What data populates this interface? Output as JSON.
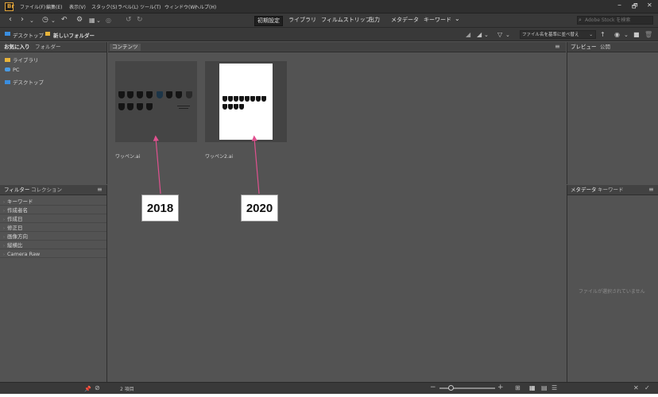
{
  "menubar": {
    "logo": "Br",
    "items": [
      "ファイル(F)",
      "編集(E)",
      "表示(V)",
      "スタック(S)",
      "ラベル(L)",
      "ツール(T)",
      "ウィンドウ(W)",
      "ヘルプ(H)"
    ],
    "minimize": "–",
    "restore": "🗗",
    "close": "✕"
  },
  "toolbar": {
    "workspaces": [
      "初期設定",
      "ライブラリ",
      "フィルムストリップ",
      "出力",
      "メタデータ",
      "キーワード"
    ],
    "more": "⌄",
    "search_placeholder": "Adobe Stock を検索"
  },
  "pathbar": {
    "crumbs": [
      "デスクトップ",
      "新しいフォルダー"
    ],
    "separator": "›",
    "sort_label": "ファイル名を基準に並べ替え",
    "sort_arrow": "⌄"
  },
  "left_panel": {
    "tabs": [
      "お気に入り",
      "フォルダー"
    ],
    "favorites": [
      "ライブラリ",
      "PC",
      "デスクトップ"
    ],
    "filter_tabs": [
      "フィルター",
      "コレクション"
    ],
    "filters": [
      "キーワード",
      "作成者名",
      "作成日",
      "修正日",
      "画像方向",
      "縦横比",
      "Camera Raw"
    ],
    "menu": "≡"
  },
  "content": {
    "tab": "コンテンツ",
    "files": [
      {
        "name": "ワッペン.ai"
      },
      {
        "name": "ワッペン2.ai"
      }
    ]
  },
  "right_panel": {
    "tabs": [
      "プレビュー",
      "公開"
    ],
    "meta_tabs": [
      "メタデータ",
      "キーワード"
    ],
    "empty_text": "ファイルが選択されていません"
  },
  "annotations": [
    {
      "label": "2018"
    },
    {
      "label": "2020"
    }
  ],
  "statusbar": {
    "count": "2 項目",
    "zoom_minus": "−",
    "zoom_plus": "+",
    "zoom_level": 0.2
  },
  "colors": {
    "accent_arrow": "#e0518f",
    "logo": "#e2a43a",
    "folder_yellow": "#e8b43a",
    "folder_blue": "#3a8ee0"
  }
}
